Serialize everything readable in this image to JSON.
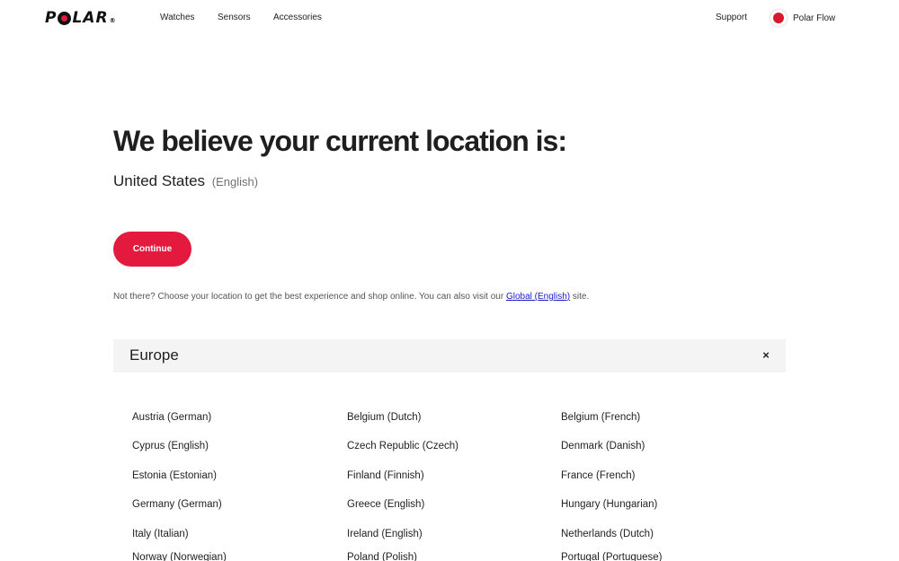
{
  "header": {
    "logo_text": "POLAR",
    "nav": [
      "Watches",
      "Sensors",
      "Accessories"
    ],
    "support": "Support",
    "flow": "Polar Flow"
  },
  "main": {
    "title": "We believe your current location is:",
    "location": "United States",
    "language": "(English)",
    "continue": "Continue",
    "note_before": "Not there? Choose your location to get the best experience and shop online. You can also visit our ",
    "note_link": "Global (English)",
    "note_after": " site."
  },
  "region": {
    "title": "Europe",
    "close": "×",
    "countries": [
      "Austria (German)",
      "Belgium (Dutch)",
      "Belgium (French)",
      "Cyprus (English)",
      "Czech Republic (Czech)",
      "Denmark (Danish)",
      "Estonia (Estonian)",
      "Finland (Finnish)",
      "France (French)",
      "Germany (German)",
      "Greece (English)",
      "Hungary (Hungarian)",
      "Italy (Italian)",
      "Ireland (English)",
      "Netherlands (Dutch)",
      "Norway (Norwegian)",
      "Poland (Polish)",
      "Portugal (Portuguese)"
    ]
  },
  "colors": {
    "accent": "#e3193e",
    "link": "#1a1ac8",
    "region_bg": "#f4f4f4"
  }
}
